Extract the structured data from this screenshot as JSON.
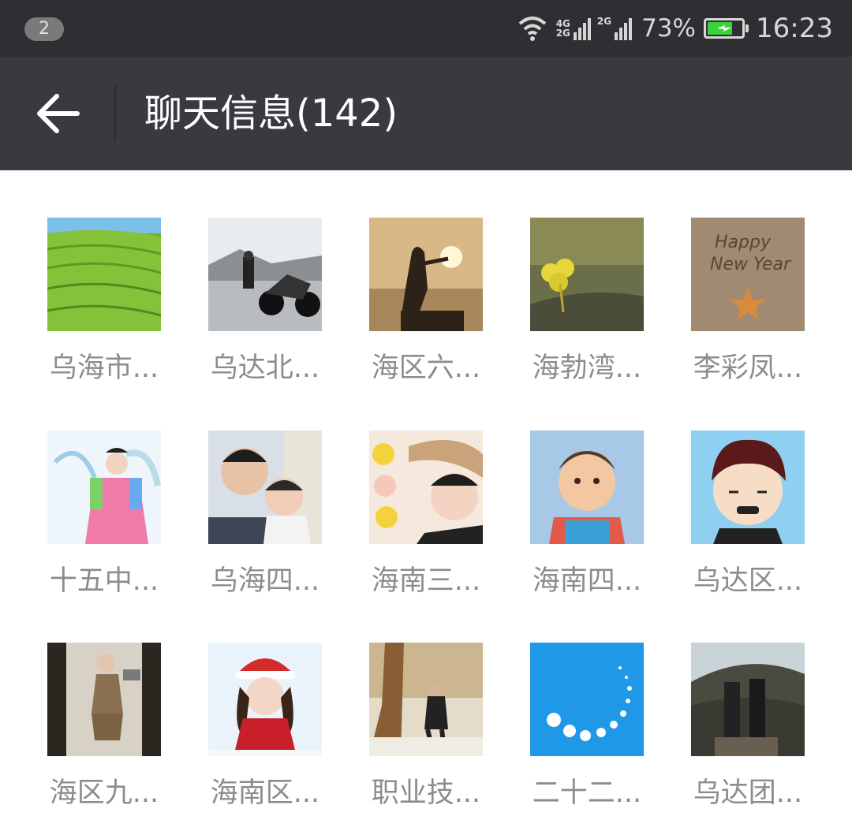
{
  "status_bar": {
    "notification_count": "2",
    "network_primary": "4G",
    "network_primary_sub": "2G",
    "network_secondary": "2G",
    "battery_percent": "73%",
    "battery_level": 0.73,
    "time": "16:23",
    "icons": [
      "wifi-icon",
      "signal-icon",
      "battery-icon"
    ]
  },
  "header": {
    "back_icon": "arrow-left-icon",
    "title": "聊天信息(142)"
  },
  "members": [
    {
      "name": "乌海市...",
      "avatar": "green-hills"
    },
    {
      "name": "乌达北...",
      "avatar": "motorcycle-rider"
    },
    {
      "name": "海区六...",
      "avatar": "sunset-silhouette"
    },
    {
      "name": "海勃湾...",
      "avatar": "clover"
    },
    {
      "name": "李彩凤...",
      "avatar": "happy-new-year-sand"
    },
    {
      "name": "十五中...",
      "avatar": "girl-hanbok"
    },
    {
      "name": "乌海四...",
      "avatar": "father-daughter"
    },
    {
      "name": "海南三...",
      "avatar": "woman-hat-stickers"
    },
    {
      "name": "海南四...",
      "avatar": "baby"
    },
    {
      "name": "乌达区...",
      "avatar": "cartoon-boy"
    },
    {
      "name": "海区九...",
      "avatar": "mirror-selfie"
    },
    {
      "name": "海南区...",
      "avatar": "christmas-girl"
    },
    {
      "name": "职业技...",
      "avatar": "man-by-tree"
    },
    {
      "name": "二十二...",
      "avatar": "loading-dots"
    },
    {
      "name": "乌达团...",
      "avatar": "hill-people"
    }
  ]
}
